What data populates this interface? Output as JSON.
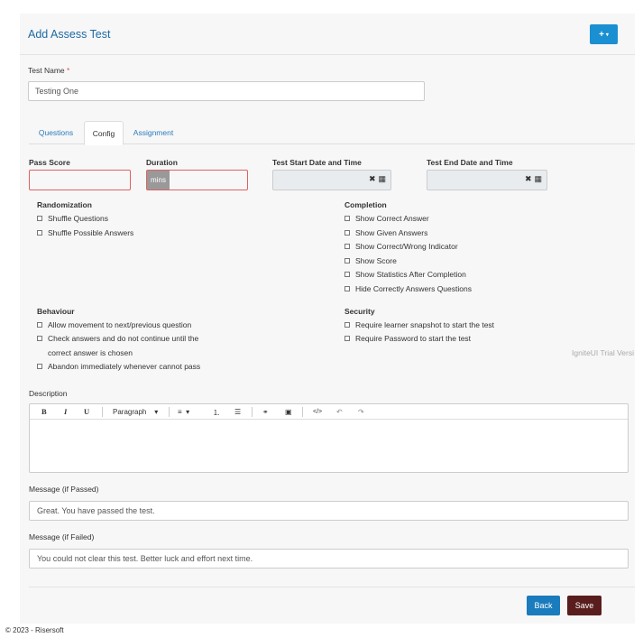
{
  "page": {
    "title": "Add Assess Test",
    "add_button_label": "+",
    "footer": "© 2023 - Risersoft",
    "trial_text": "IgniteUI Trial Versi"
  },
  "test_name": {
    "label": "Test Name",
    "required_mark": "*",
    "value": "Testing One"
  },
  "tabs": [
    {
      "label": "Questions",
      "active": false
    },
    {
      "label": "Config",
      "active": true
    },
    {
      "label": "Assignment",
      "active": false
    }
  ],
  "config": {
    "pass_score_label": "Pass Score",
    "duration_label": "Duration",
    "duration_unit": "mins",
    "start_label": "Test Start Date and Time",
    "end_label": "Test End Date and Time",
    "clear_icon": "✖",
    "calendar_icon": "▦"
  },
  "randomization": {
    "heading": "Randomization",
    "items": [
      "Shuffle Questions",
      "Shuffle Possible Answers"
    ]
  },
  "completion": {
    "heading": "Completion",
    "items": [
      "Show Correct Answer",
      "Show Given Answers",
      "Show Correct/Wrong Indicator",
      "Show Score",
      "Show Statistics After Completion",
      "Hide Correctly Answers Questions"
    ]
  },
  "behaviour": {
    "heading": "Behaviour",
    "items": [
      "Allow movement to next/previous question",
      "Check answers and do not continue until the",
      "correct answer is chosen",
      "Abandon immediately whenever cannot pass"
    ]
  },
  "security": {
    "heading": "Security",
    "items": [
      "Require learner snapshot to start the test",
      "Require Password to start the test"
    ]
  },
  "description": {
    "label": "Description",
    "toolbar": {
      "bold": "B",
      "italic": "I",
      "underline": "U",
      "paragraph": "Paragraph",
      "align": "≡",
      "ordered_list": "⒈",
      "bullet_list": "☰",
      "link": "⚭",
      "image": "▣",
      "code": "</>",
      "undo": "↶",
      "redo": "↷",
      "caret": "▾"
    }
  },
  "message_passed": {
    "label": "Message (if Passed)",
    "value": "Great. You have passed the test."
  },
  "message_failed": {
    "label": "Message (if Failed)",
    "value": "You could not clear this test. Better luck and effort next time."
  },
  "actions": {
    "back": "Back",
    "save": "Save"
  },
  "colors": {
    "title": "#1b6aa5",
    "add_button": "#1a8fd1",
    "back_button": "#1a7bbd",
    "save_button": "#5a1d1d",
    "error_border": "#e06161"
  }
}
